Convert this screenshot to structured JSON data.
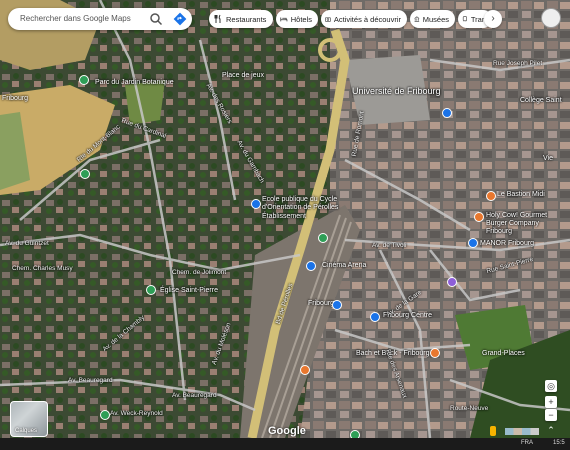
{
  "search": {
    "placeholder": "Rechercher dans Google Maps",
    "search_icon": "search-icon",
    "directions_icon": "directions-icon"
  },
  "chips": [
    {
      "label": "Restaurants",
      "icon": "restaurant-icon"
    },
    {
      "label": "Hôtels",
      "icon": "hotel-icon"
    },
    {
      "label": "Activités à découvrir",
      "icon": "camera-icon"
    },
    {
      "label": "Musées",
      "icon": "museum-icon"
    },
    {
      "label": "Tran",
      "icon": "transit-icon"
    }
  ],
  "map": {
    "places": {
      "universite": "Université de Fribourg",
      "ecole": "Ecole publique du Cycle d'Orientation de Pérolles",
      "ecole_sub": "Établissement",
      "bastion": "Le Bastion Midi",
      "holy": "Holy Cow! Gourmet Burger Company Fribourg",
      "manor": "MANOR Fribourg",
      "bach": "Bach et Buck - Fribourg",
      "fribourg": "Fribourg",
      "fribourg_centre": "Fribourg Centre",
      "college": "Collège Saint",
      "eglise": "Église Saint-Pierre",
      "cinema": "Cinéma Arena",
      "grand_places": "Grand-Places",
      "parc": "Parc du Jardin Botanique",
      "place_jeux": "Place de jeux",
      "vie": "Vie",
      "fribourg_left": "Fribourg"
    },
    "roads": {
      "pilet": "Rue Joseph Pilet",
      "tivoli": "Av. de Tivoli",
      "gare": "Av. de la Gare",
      "saint_pierre": "Rue Saint-Pierre",
      "beauregard": "Av. Beauregard",
      "beauregard2": "Av. Beauregard",
      "guintzet": "Av. du Guintzet",
      "musy": "Chem. Charles Musy",
      "jolimont": "Chem. de Jolimont",
      "gambach": "Av. du Gambach",
      "rosiers": "Av. des Rosiers",
      "mont_blanc": "Rte du Mont-Blanc",
      "cardinal": "Rue du Cardinal",
      "perolles": "Bd de Pérolles",
      "pérolles_bd": "Rue de Romont",
      "neuve": "Route-Neuve",
      "chambly": "Av. de la Chambly",
      "gruyere": "Av. du Moléson",
      "arsenaux": "Rte des Arsenaux",
      "weck": "Av. Weck-Reynold"
    },
    "pins": {
      "restaurant": "#e8772e",
      "shopping": "#1a73e8",
      "attraction": "#2e9e56",
      "purple": "#8e5ed9"
    }
  },
  "layers_label": "Calques",
  "logo": "Google",
  "taskbar": {
    "lang": "FRA",
    "time": "15:5"
  }
}
